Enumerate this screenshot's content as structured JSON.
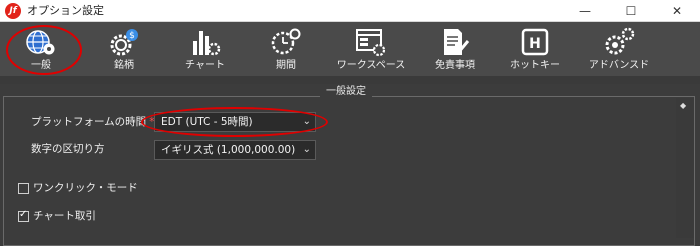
{
  "window": {
    "title": "オプション設定",
    "logo_text": "Jf",
    "minimize_glyph": "—",
    "maximize_glyph": "☐",
    "close_glyph": "✕"
  },
  "toolbar": {
    "items": [
      {
        "label": "一般",
        "icon": "globe-gear-icon"
      },
      {
        "label": "銘柄",
        "icon": "gear-dollar-icon"
      },
      {
        "label": "チャート",
        "icon": "bar-chart-gear-icon"
      },
      {
        "label": "期間",
        "icon": "clock-gear-icon"
      },
      {
        "label": "ワークスペース",
        "icon": "window-gear-icon"
      },
      {
        "label": "免責事項",
        "icon": "document-pen-icon"
      },
      {
        "label": "ホットキー",
        "icon": "hotkey-h-icon"
      },
      {
        "label": "アドバンスド",
        "icon": "gears-icon"
      }
    ],
    "active": "一般"
  },
  "panel": {
    "title": "一般設定",
    "platform_time": {
      "label": "プラットフォームの時間",
      "required_mark": "*",
      "value": "EDT (UTC - 5時間)"
    },
    "number_format": {
      "label": "数字の区切り方",
      "value": "イギリス式 (1,000,000.00)"
    },
    "one_click_mode": {
      "label": "ワンクリック・モード",
      "checked": false
    },
    "chart_trading": {
      "label": "チャート取引",
      "checked": true
    }
  },
  "colors": {
    "highlight": "#e00000",
    "background": "#3c3c3c",
    "toolbar": "#4a4a4a"
  }
}
